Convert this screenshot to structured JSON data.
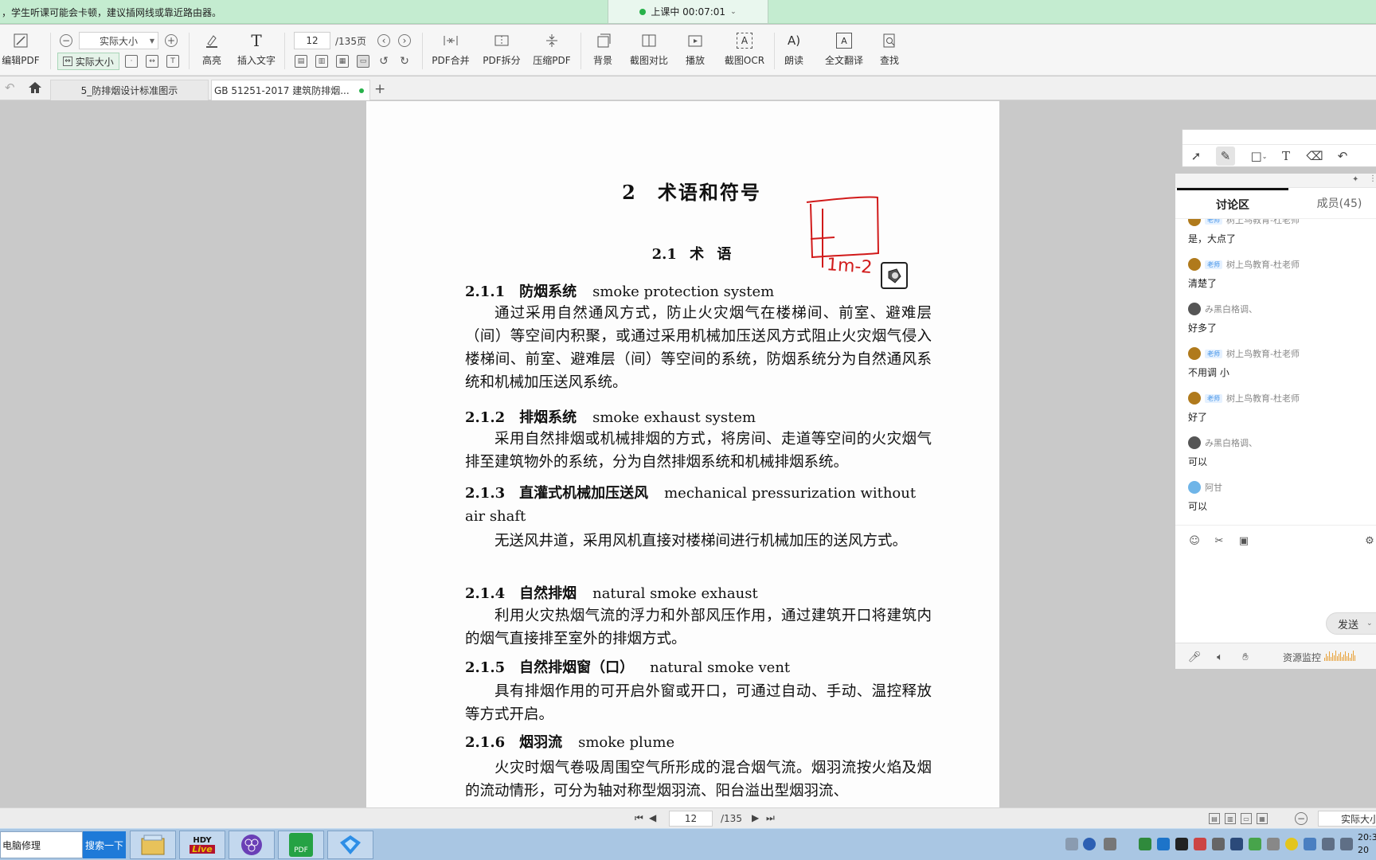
{
  "notice": {
    "text": "，学生听课可能会卡顿，建议插网线或靠近路由器。",
    "timer": "上课中 00:07:01"
  },
  "toolbar": {
    "edit_pdf": "编辑PDF",
    "zoom_value": "实际大小",
    "fit_actual": "实际大小",
    "highlight": "高亮",
    "insert_text": "插入文字",
    "page_current": "12",
    "page_total": "/135页",
    "pdf_merge": "PDF合并",
    "pdf_split": "PDF拆分",
    "compress_pdf": "压缩PDF",
    "background": "背景",
    "screenshot_compare": "截图对比",
    "play": "播放",
    "screenshot_ocr": "截图OCR",
    "read_aloud": "朗读",
    "full_translate": "全文翻译",
    "find": "查找"
  },
  "tabs": {
    "tab1": "5_防排烟设计标准图示",
    "tab2": "GB 51251-2017 建筑防排烟..."
  },
  "document": {
    "chapter_title": "2　术语和符号",
    "section_title": "2.1 术 语",
    "annotation_text": "1m-2",
    "terms": [
      {
        "num": "2.1.1",
        "cn": "防烟系统",
        "en": "smoke protection system",
        "body": "通过采用自然通风方式，防止火灾烟气在楼梯间、前室、避难层（间）等空间内积聚，或通过采用机械加压送风方式阻止火灾烟气侵入楼梯间、前室、避难层（间）等空间的系统，防烟系统分为自然通风系统和机械加压送风系统。"
      },
      {
        "num": "2.1.2",
        "cn": "排烟系统",
        "en": "smoke exhaust system",
        "body": "采用自然排烟或机械排烟的方式，将房间、走道等空间的火灾烟气排至建筑物外的系统，分为自然排烟系统和机械排烟系统。"
      },
      {
        "num": "2.1.3",
        "cn": "直灌式机械加压送风",
        "en": "mechanical pressurization without air shaft",
        "body": "无送风井道，采用风机直接对楼梯间进行机械加压的送风方式。"
      },
      {
        "num": "2.1.4",
        "cn": "自然排烟",
        "en": "natural smoke exhaust",
        "body": "利用火灾热烟气流的浮力和外部风压作用，通过建筑开口将建筑内的烟气直接排至室外的排烟方式。"
      },
      {
        "num": "2.1.5",
        "cn": "自然排烟窗（口）",
        "en": "natural smoke vent",
        "body": "具有排烟作用的可开启外窗或开口，可通过自动、手动、温控释放等方式开启。"
      },
      {
        "num": "2.1.6",
        "cn": "烟羽流",
        "en": "smoke plume",
        "body": "火灾时烟气卷吸周围空气所形成的混合烟气流。烟羽流按火焰及烟的流动情形，可分为轴对称型烟羽流、阳台溢出型烟羽流、"
      }
    ]
  },
  "panel": {
    "tab_discussion": "讨论区",
    "tab_members": "成员(45)",
    "teacher_badge": "老师",
    "messages": [
      {
        "user": "树上鸟教育-杜老师",
        "text": "是，大点了",
        "teacher": true
      },
      {
        "user": "树上鸟教育-杜老师",
        "text": "清楚了",
        "teacher": true
      },
      {
        "user": "み黑白格调、",
        "text": "好多了",
        "teacher": false
      },
      {
        "user": "树上鸟教育-杜老师",
        "text": "不用调 小",
        "teacher": true
      },
      {
        "user": "树上鸟教育-杜老师",
        "text": "好了",
        "teacher": true
      },
      {
        "user": "み黑白格调、",
        "text": "可以",
        "teacher": false
      },
      {
        "user": "阿甘",
        "text": "可以",
        "teacher": false
      }
    ],
    "send_label": "发送",
    "resource_monitor": "资源监控"
  },
  "statusbar": {
    "page_current": "12",
    "page_total": "/135",
    "zoom": "实际大小"
  },
  "taskbar": {
    "search_text": "电脑修理",
    "search_button": "搜索一下",
    "hdy_label": "HDY",
    "live_label": "Live",
    "pdf_label": "PDF",
    "clock_time": "20:3",
    "clock_date": "20"
  },
  "colors": {
    "accent_green": "#27b24a",
    "annotation_red": "#d11a1a",
    "taskbar_blue": "#a9c6e3"
  }
}
